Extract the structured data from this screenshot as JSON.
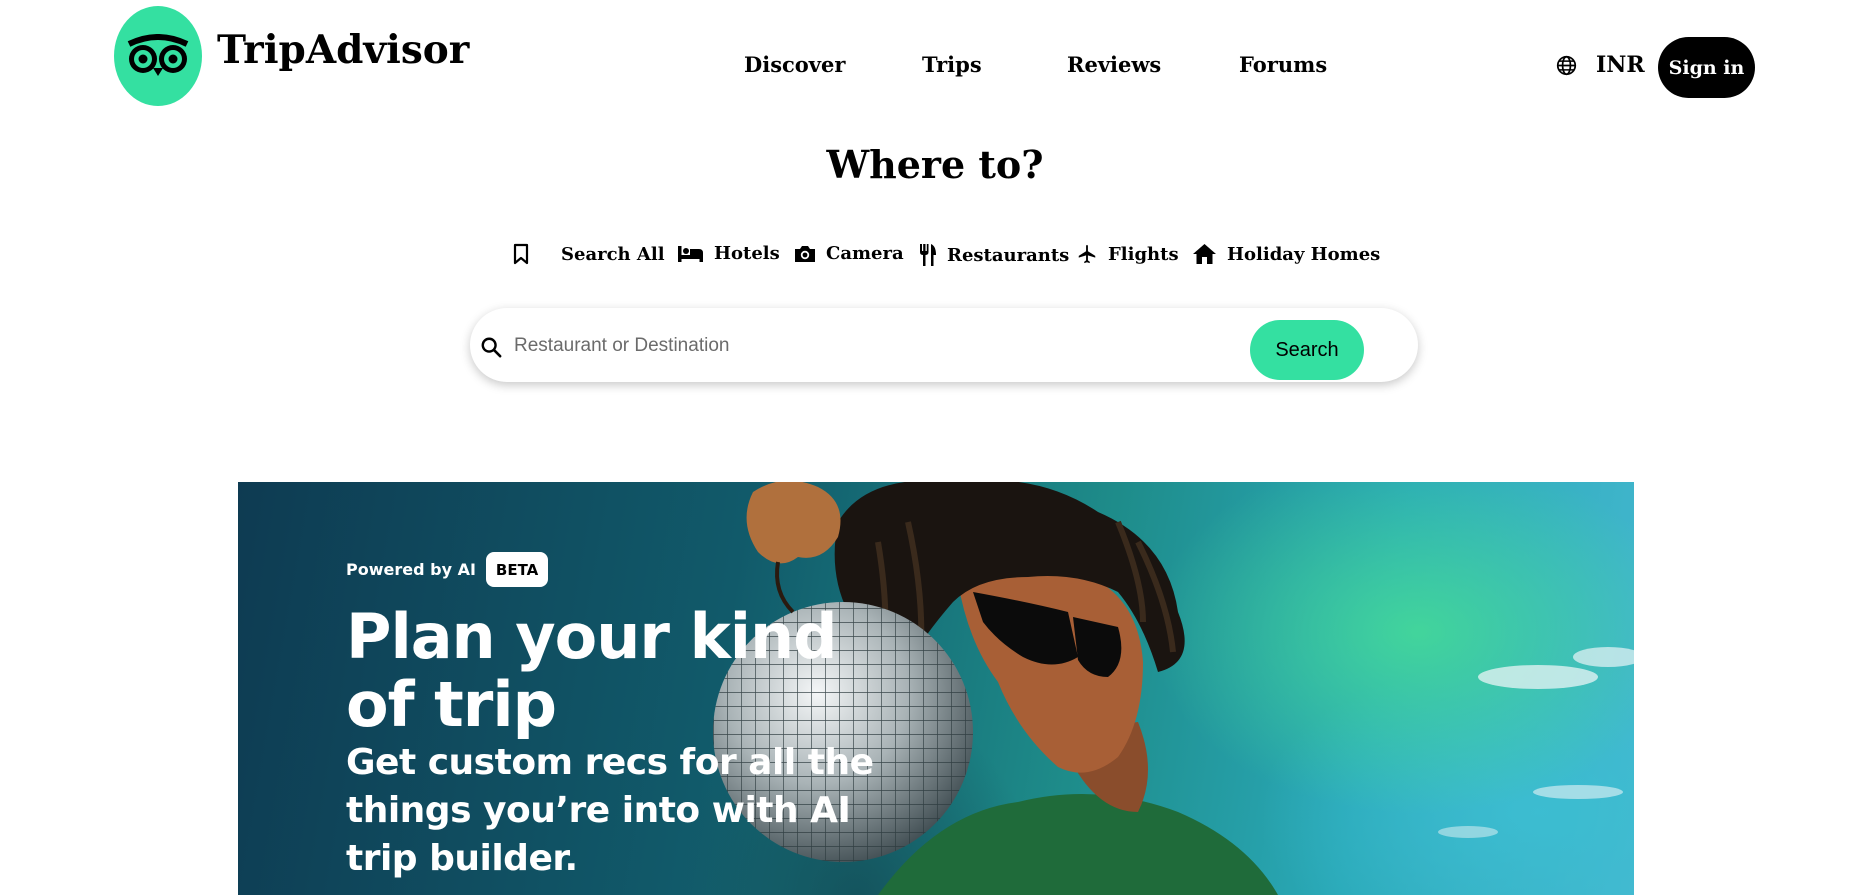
{
  "header": {
    "brand": "TripAdvisor",
    "nav": [
      "Discover",
      "Trips",
      "Reviews",
      "Forums"
    ],
    "currency": "INR",
    "signin_label": "Sign in"
  },
  "hero": {
    "title": "Where to?"
  },
  "tabs": [
    {
      "label": "Search All",
      "icon": "bookmark-icon"
    },
    {
      "label": "Hotels",
      "icon": "bed-icon"
    },
    {
      "label": "Camera",
      "icon": "camera-icon"
    },
    {
      "label": "Restaurants",
      "icon": "fork-knife-icon"
    },
    {
      "label": "Flights",
      "icon": "plane-icon"
    },
    {
      "label": "Holiday Homes",
      "icon": "house-icon"
    }
  ],
  "search": {
    "placeholder": "Restaurant or Destination",
    "button_label": "Search"
  },
  "banner": {
    "powered_label": "Powered by AI",
    "beta_label": "BETA",
    "headline": "Plan your kind of trip",
    "subhead": "Get custom recs for all the things you’re into with AI trip builder."
  },
  "colors": {
    "brand_green": "#34e0a1",
    "signin_bg": "#000000"
  }
}
